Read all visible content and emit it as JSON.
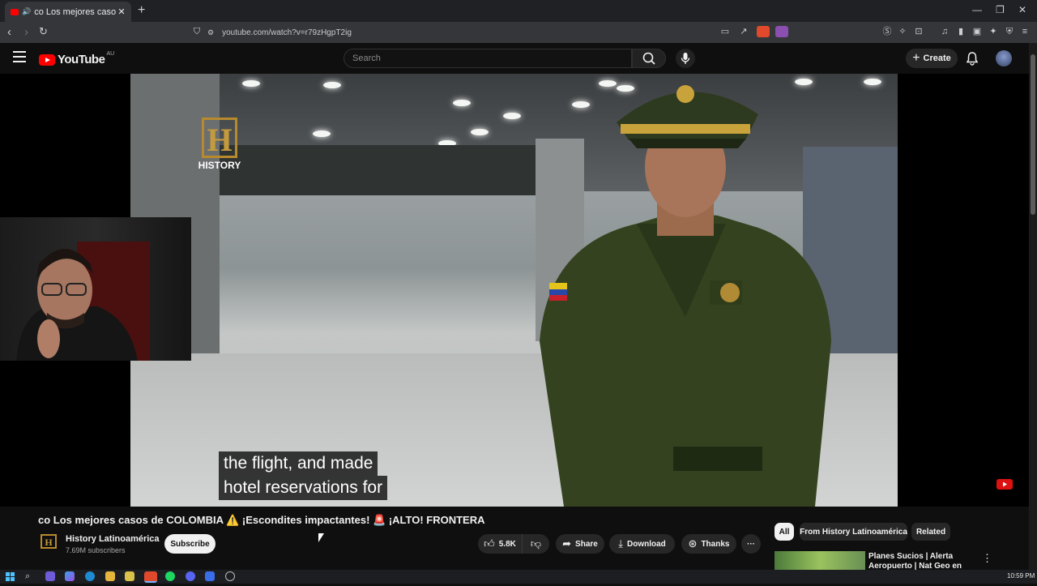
{
  "browser": {
    "tab_title": "co Los mejores casos de COLOMBIA",
    "new_tab": "+",
    "tab_close": "✕",
    "url": "youtube.com/watch?v=r79zHgpT2ig"
  },
  "youtube": {
    "logo": "YouTube",
    "region": "AU",
    "search_placeholder": "Search",
    "create_label": "Create"
  },
  "video": {
    "channel_watermark": "HISTORY",
    "caption_lines": [
      "the flight, and made",
      "hotel reservations for"
    ],
    "title": "co Los mejores casos de COLOMBIA ⚠️ ¡Escondites impactantes! 🚨 ¡ALTO! FRONTERA"
  },
  "channel": {
    "name": "History Latinoamérica",
    "subscribers": "7.69M subscribers",
    "subscribe_label": "Subscribe"
  },
  "actions": {
    "likes": "5.8K",
    "share": "Share",
    "download": "Download",
    "thanks": "Thanks",
    "more": "···"
  },
  "chips": [
    "All",
    "From History Latinoamérica",
    "Related"
  ],
  "recommendation": {
    "title": "Planes Sucios | Alerta Aeropuerto | Nat Geo en"
  },
  "taskbar": {
    "clock": "10:59 PM"
  },
  "colors": {
    "youtube_red": "#ff0000",
    "background": "#0f0f0f",
    "chip_bg": "#272727"
  }
}
